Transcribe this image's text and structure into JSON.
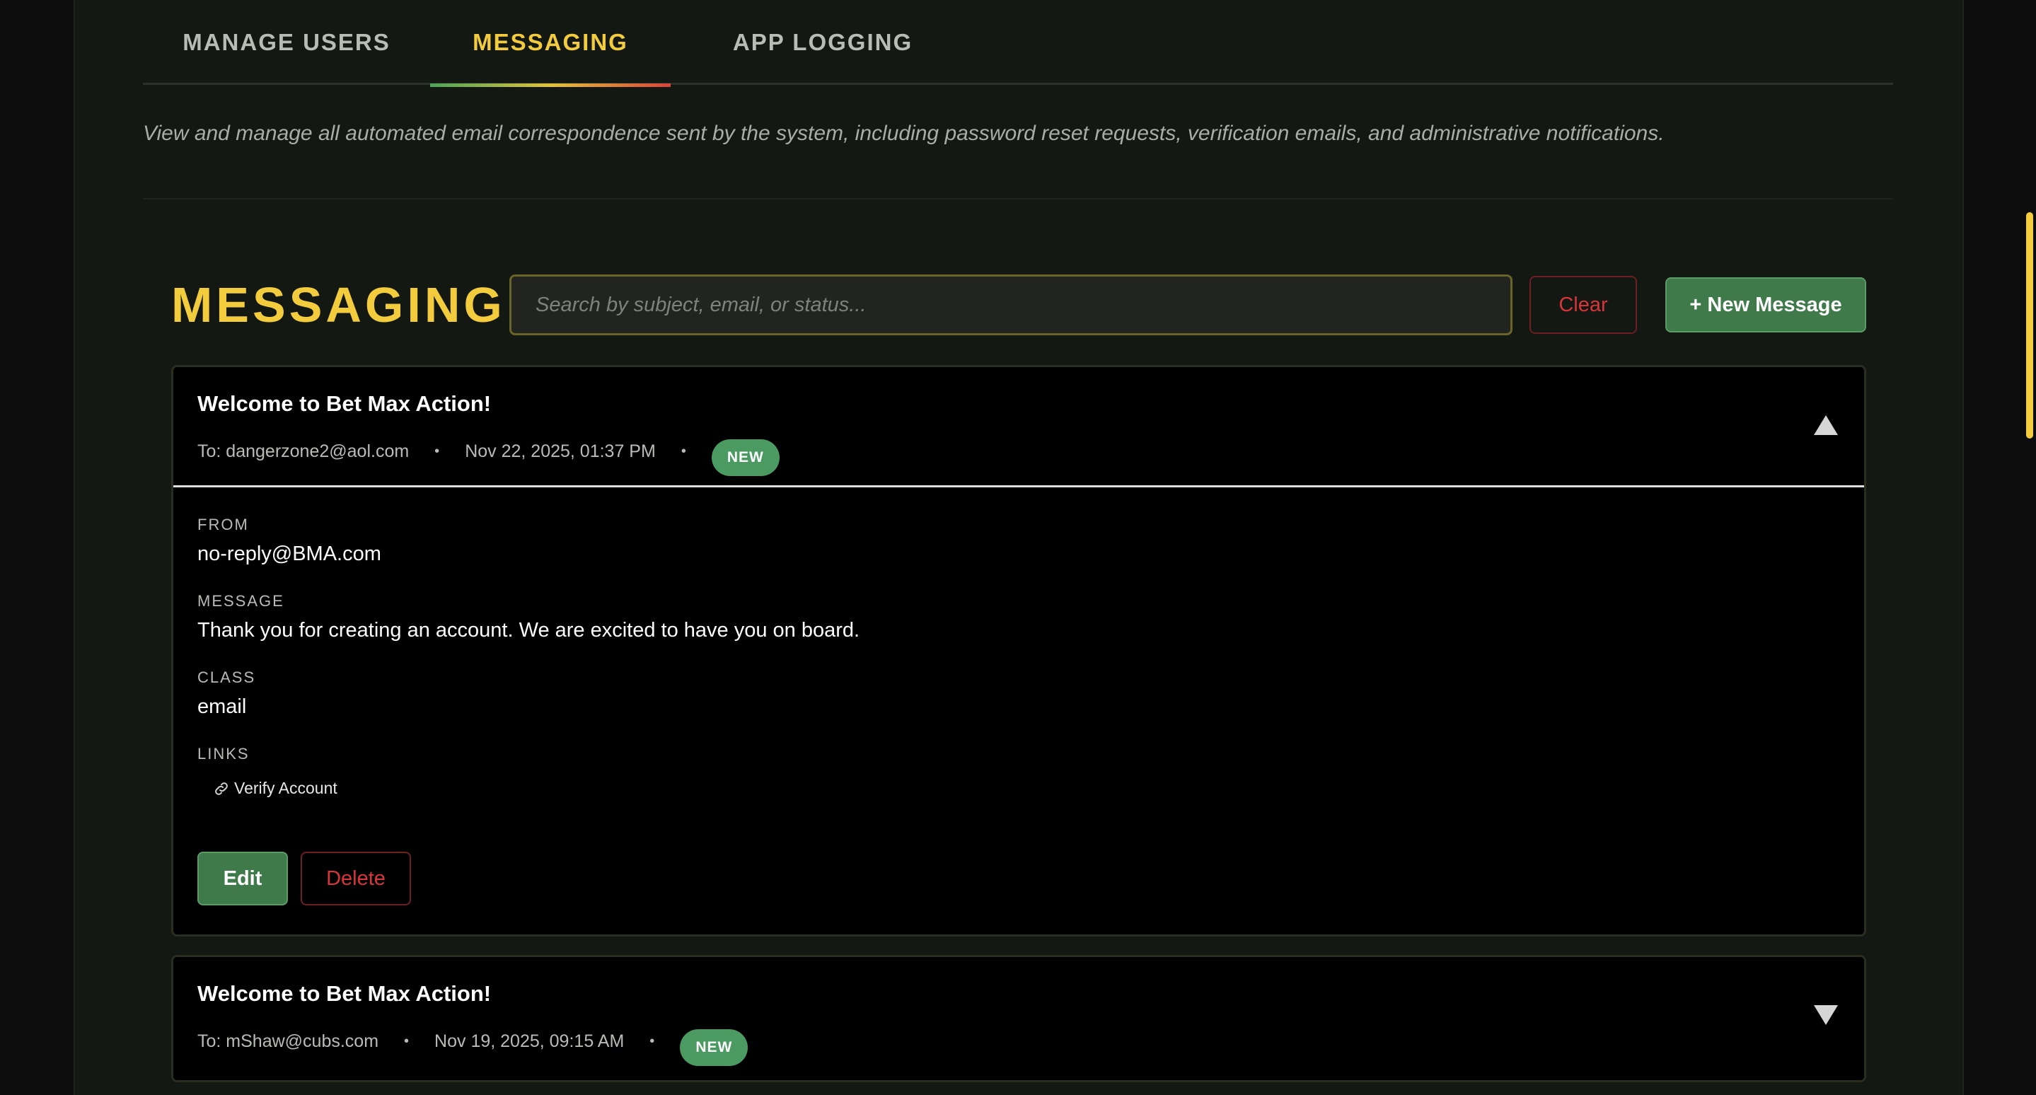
{
  "tabs": [
    {
      "label": "MANAGE USERS",
      "active": false
    },
    {
      "label": "MESSAGING",
      "active": true
    },
    {
      "label": "APP LOGGING",
      "active": false
    }
  ],
  "description": "View and manage all automated email correspondence sent by the system, including password reset requests, verification emails, and administrative notifications.",
  "messaging": {
    "title": "MESSAGING",
    "search_placeholder": "Search by subject, email, or status...",
    "clear_label": "Clear",
    "new_message_label": "+ New Message"
  },
  "messages": [
    {
      "subject": "Welcome to Bet Max Action!",
      "to": "To: dangerzone2@aol.com",
      "date": "Nov 22, 2025, 01:37 PM",
      "status": "NEW",
      "expanded": true,
      "from_label": "FROM",
      "from": "no-reply@BMA.com",
      "message_label": "MESSAGE",
      "message": "Thank you for creating an account. We are excited to have you on board.",
      "class_label": "CLASS",
      "class": "email",
      "links_label": "LINKS",
      "links": [
        "Verify Account"
      ],
      "edit_label": "Edit",
      "delete_label": "Delete"
    },
    {
      "subject": "Welcome to Bet Max Action!",
      "to": "To: mShaw@cubs.com",
      "date": "Nov 19, 2025, 09:15 AM",
      "status": "NEW",
      "expanded": false
    }
  ],
  "separator": "•",
  "colors": {
    "accent": "#f2cc3d",
    "success": "#4a9a62",
    "danger": "#d8353b",
    "background": "#141813"
  },
  "icons": {
    "collapse": "triangle-up-icon",
    "expand": "triangle-down-icon",
    "link": "link-icon"
  }
}
